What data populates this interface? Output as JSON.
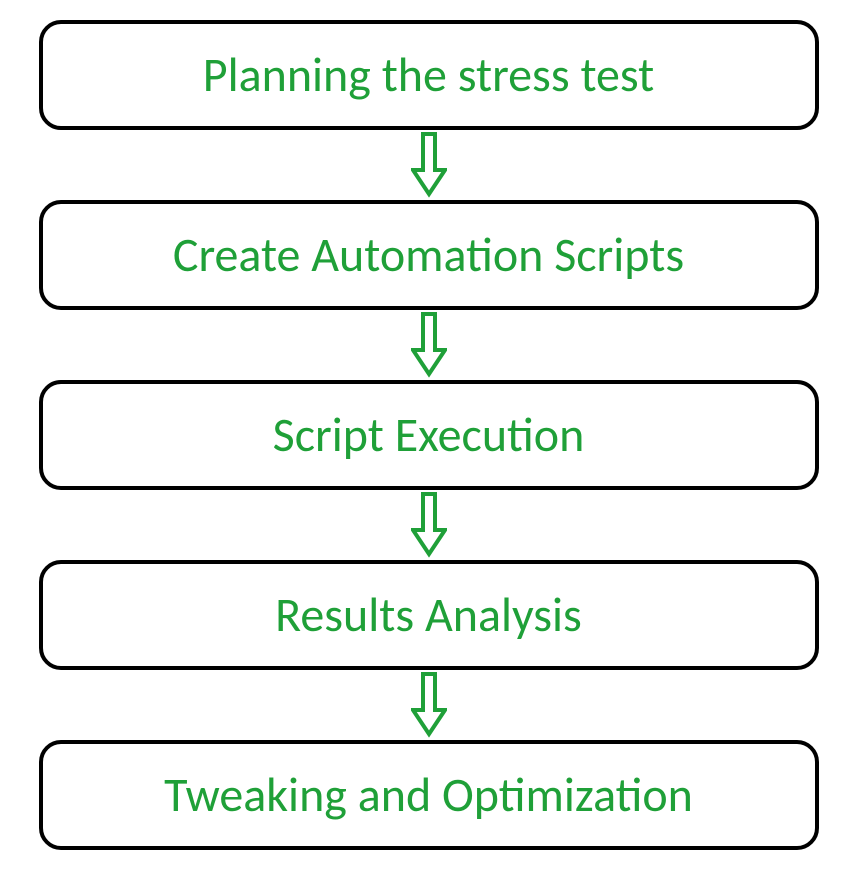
{
  "flow": {
    "steps": [
      {
        "label": "Planning the stress test"
      },
      {
        "label": "Create Automation Scripts"
      },
      {
        "label": "Script Execution"
      },
      {
        "label": "Results Analysis"
      },
      {
        "label": "Tweaking and Optimization"
      }
    ]
  },
  "colors": {
    "text": "#1fa038",
    "arrowStroke": "#1fa038",
    "boxBorder": "#000000"
  }
}
